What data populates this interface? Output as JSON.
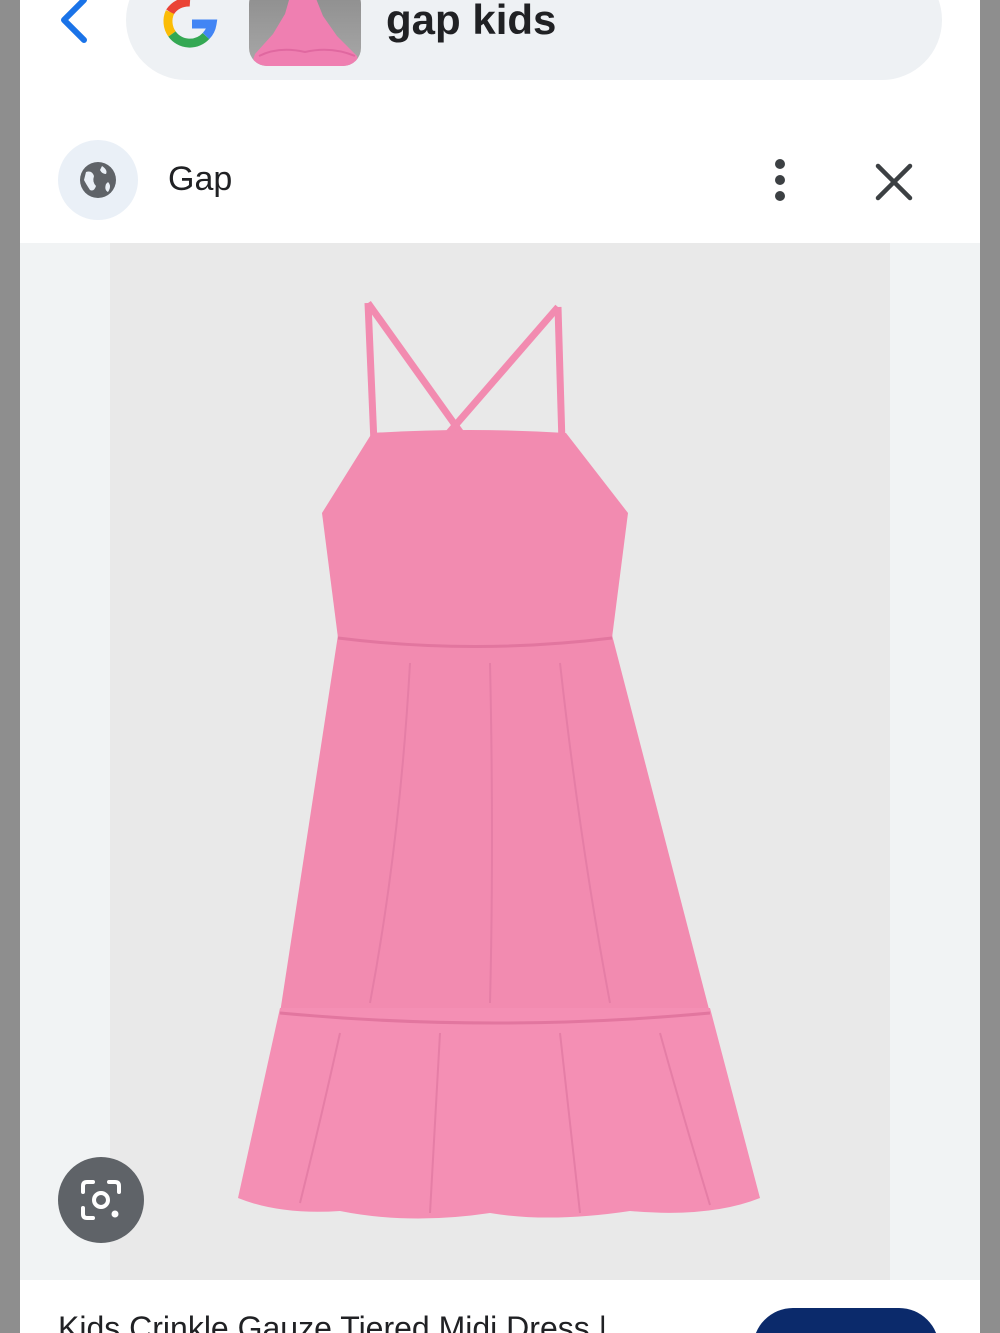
{
  "search": {
    "query": "gap kids",
    "back_icon": "back-arrow-icon",
    "engine_logo": "google-g-logo",
    "thumbnail_desc": "pink-dress-thumbnail"
  },
  "result": {
    "site_name": "Gap",
    "site_icon": "globe-icon",
    "more_icon": "more-vert-icon",
    "close_icon": "close-icon",
    "title": "Kids Crinkle Gauze Tiered Midi Dress |",
    "lens_icon": "lens-search-icon"
  },
  "colors": {
    "back_blue": "#1a73e8",
    "dress_pink": "#f28bb0",
    "button_navy": "#0b2a6b"
  }
}
